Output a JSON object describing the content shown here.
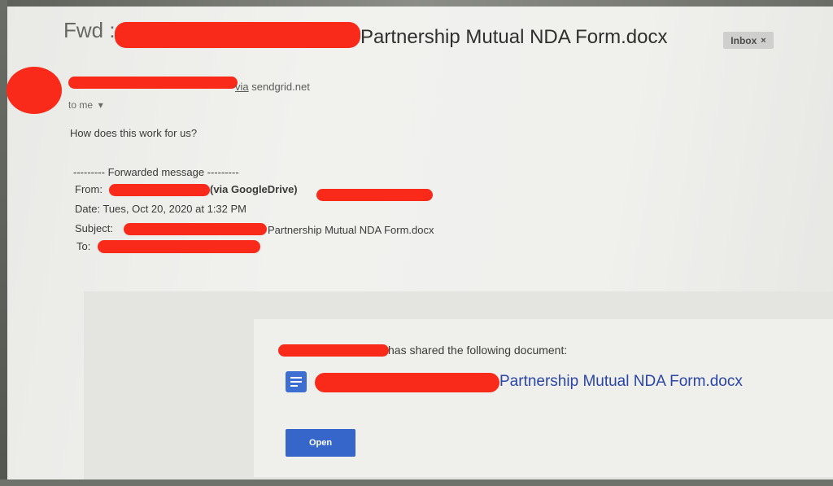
{
  "email": {
    "subject_prefix": "Fwd :",
    "subject_title": "Partnership Mutual NDA Form.docx",
    "label_chip": "Inbox",
    "label_chip_close": "×",
    "sender_via": "via",
    "sender_via_domain": "sendgrid.net",
    "recipient": "to me",
    "recipient_chevron": "▾",
    "body_text": "How does this work for us?",
    "forwarded": {
      "header": "--------- Forwarded message ---------",
      "from_label": "From:",
      "from_via": "(via GoogleDrive)",
      "date_line": "Date: Tues, Oct 20, 2020 at 1:32 PM",
      "subject_label": "Subject:",
      "subject_value": "Partnership Mutual NDA Form.docx",
      "to_label": "To:"
    },
    "share_card": {
      "shared_text": "has shared the following document:",
      "doc_name": "Partnership Mutual NDA Form.docx",
      "doc_icon": "google-docs-icon",
      "open_button": "Open"
    }
  },
  "colors": {
    "redaction": "#fa2a1a",
    "link_blue": "#2b46a6",
    "button_blue": "#3766cb",
    "doc_icon_blue": "#3d6fd3"
  }
}
